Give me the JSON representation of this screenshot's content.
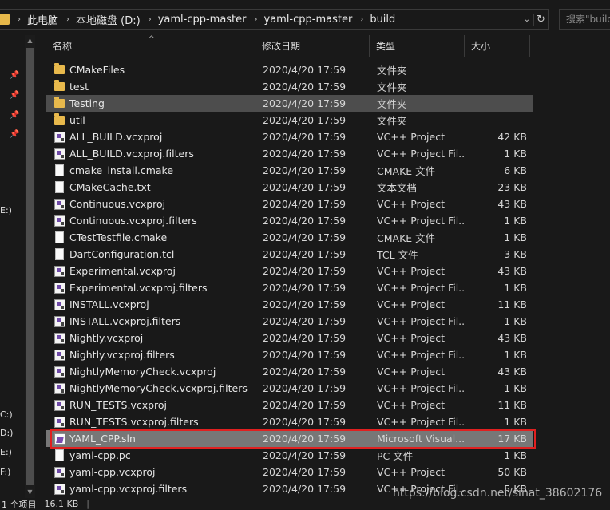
{
  "address_bar": {
    "crumbs": [
      "此电脑",
      "本地磁盘 (D:)",
      "yaml-cpp-master",
      "yaml-cpp-master",
      "build"
    ],
    "search_placeholder": "搜索\"build\""
  },
  "nav_drives": [
    "E:)",
    "C:)",
    "D:)",
    "E:)",
    "F:)"
  ],
  "columns": {
    "name": "名称",
    "date": "修改日期",
    "type": "类型",
    "size": "大小"
  },
  "files": [
    {
      "name": "CMakeFiles",
      "date": "2020/4/20 17:59",
      "type": "文件夹",
      "size": "",
      "icon": "folder-icon"
    },
    {
      "name": "test",
      "date": "2020/4/20 17:59",
      "type": "文件夹",
      "size": "",
      "icon": "folder-icon"
    },
    {
      "name": "Testing",
      "date": "2020/4/20 17:59",
      "type": "文件夹",
      "size": "",
      "icon": "folder-icon"
    },
    {
      "name": "util",
      "date": "2020/4/20 17:59",
      "type": "文件夹",
      "size": "",
      "icon": "folder-icon"
    },
    {
      "name": "ALL_BUILD.vcxproj",
      "date": "2020/4/20 17:59",
      "type": "VC++ Project",
      "size": "42 KB",
      "icon": "vcxproj-icon"
    },
    {
      "name": "ALL_BUILD.vcxproj.filters",
      "date": "2020/4/20 17:59",
      "type": "VC++ Project Fil...",
      "size": "1 KB",
      "icon": "vcxproj-icon"
    },
    {
      "name": "cmake_install.cmake",
      "date": "2020/4/20 17:59",
      "type": "CMAKE 文件",
      "size": "6 KB",
      "icon": "document-icon"
    },
    {
      "name": "CMakeCache.txt",
      "date": "2020/4/20 17:59",
      "type": "文本文档",
      "size": "23 KB",
      "icon": "document-icon"
    },
    {
      "name": "Continuous.vcxproj",
      "date": "2020/4/20 17:59",
      "type": "VC++ Project",
      "size": "43 KB",
      "icon": "vcxproj-icon"
    },
    {
      "name": "Continuous.vcxproj.filters",
      "date": "2020/4/20 17:59",
      "type": "VC++ Project Fil...",
      "size": "1 KB",
      "icon": "vcxproj-icon"
    },
    {
      "name": "CTestTestfile.cmake",
      "date": "2020/4/20 17:59",
      "type": "CMAKE 文件",
      "size": "1 KB",
      "icon": "document-icon"
    },
    {
      "name": "DartConfiguration.tcl",
      "date": "2020/4/20 17:59",
      "type": "TCL 文件",
      "size": "3 KB",
      "icon": "document-icon"
    },
    {
      "name": "Experimental.vcxproj",
      "date": "2020/4/20 17:59",
      "type": "VC++ Project",
      "size": "43 KB",
      "icon": "vcxproj-icon"
    },
    {
      "name": "Experimental.vcxproj.filters",
      "date": "2020/4/20 17:59",
      "type": "VC++ Project Fil...",
      "size": "1 KB",
      "icon": "vcxproj-icon"
    },
    {
      "name": "INSTALL.vcxproj",
      "date": "2020/4/20 17:59",
      "type": "VC++ Project",
      "size": "11 KB",
      "icon": "vcxproj-icon"
    },
    {
      "name": "INSTALL.vcxproj.filters",
      "date": "2020/4/20 17:59",
      "type": "VC++ Project Fil...",
      "size": "1 KB",
      "icon": "vcxproj-icon"
    },
    {
      "name": "Nightly.vcxproj",
      "date": "2020/4/20 17:59",
      "type": "VC++ Project",
      "size": "43 KB",
      "icon": "vcxproj-icon"
    },
    {
      "name": "Nightly.vcxproj.filters",
      "date": "2020/4/20 17:59",
      "type": "VC++ Project Fil...",
      "size": "1 KB",
      "icon": "vcxproj-icon"
    },
    {
      "name": "NightlyMemoryCheck.vcxproj",
      "date": "2020/4/20 17:59",
      "type": "VC++ Project",
      "size": "43 KB",
      "icon": "vcxproj-icon"
    },
    {
      "name": "NightlyMemoryCheck.vcxproj.filters",
      "date": "2020/4/20 17:59",
      "type": "VC++ Project Fil...",
      "size": "1 KB",
      "icon": "vcxproj-icon"
    },
    {
      "name": "RUN_TESTS.vcxproj",
      "date": "2020/4/20 17:59",
      "type": "VC++ Project",
      "size": "11 KB",
      "icon": "vcxproj-icon"
    },
    {
      "name": "RUN_TESTS.vcxproj.filters",
      "date": "2020/4/20 17:59",
      "type": "VC++ Project Fil...",
      "size": "1 KB",
      "icon": "vcxproj-icon"
    },
    {
      "name": "YAML_CPP.sln",
      "date": "2020/4/20 17:59",
      "type": "Microsoft Visual...",
      "size": "17 KB",
      "icon": "sln-icon"
    },
    {
      "name": "yaml-cpp.pc",
      "date": "2020/4/20 17:59",
      "type": "PC 文件",
      "size": "1 KB",
      "icon": "document-icon"
    },
    {
      "name": "yaml-cpp.vcxproj",
      "date": "2020/4/20 17:59",
      "type": "VC++ Project",
      "size": "50 KB",
      "icon": "vcxproj-icon"
    },
    {
      "name": "yaml-cpp.vcxproj.filters",
      "date": "2020/4/20 17:59",
      "type": "VC++ Project Fil...",
      "size": "5 KB",
      "icon": "vcxproj-icon"
    }
  ],
  "hover_row_name": "Testing",
  "selected_row_name": "YAML_CPP.sln",
  "status": {
    "selection": "1 个项目",
    "size": "16.1 KB"
  },
  "watermark": "https://blog.csdn.net/sinat_38602176",
  "colors": {
    "background": "#191919",
    "selected_row": "#777777",
    "highlight_box": "#e02020"
  }
}
